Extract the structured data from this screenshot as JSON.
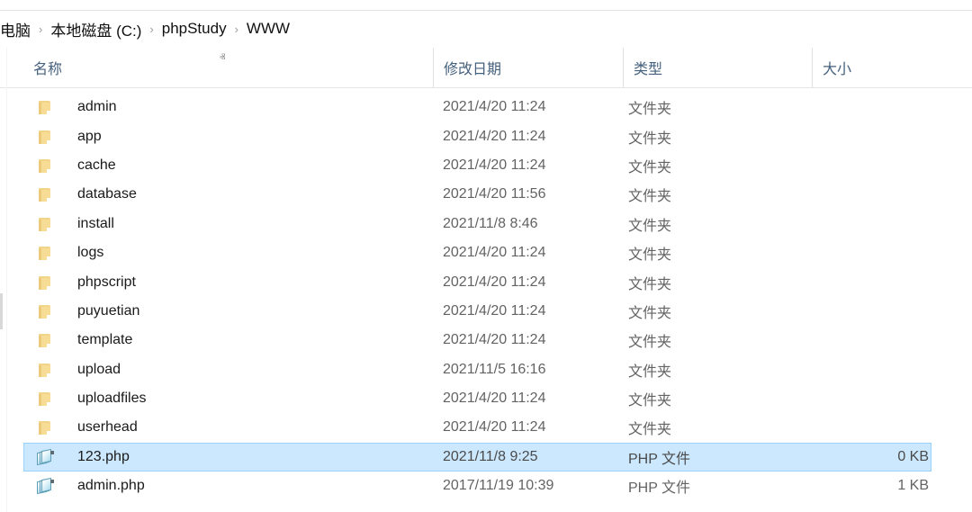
{
  "window": {
    "type": "windows-file-explorer",
    "accent_selection_fill": "#cce8ff",
    "accent_selection_border": "#99d1ff",
    "header_text_color": "#45617d",
    "folder_icon_color": "#f7dc95"
  },
  "breadcrumb": {
    "name": "address-bar",
    "separator": "›",
    "crumbs": [
      {
        "label": "电脑"
      },
      {
        "label": "本地磁盘 (C:)"
      },
      {
        "label": "phpStudy"
      },
      {
        "label": "WWW"
      }
    ]
  },
  "columns": {
    "sort_caret": "ⱏ",
    "sorted_by": "名称",
    "sort_direction": "ascending",
    "headers": [
      {
        "label": "名称",
        "key": "name"
      },
      {
        "label": "修改日期",
        "key": "date"
      },
      {
        "label": "类型",
        "key": "type"
      },
      {
        "label": "大小",
        "key": "size"
      }
    ]
  },
  "file_list": {
    "selected_index": 12,
    "rows": [
      {
        "name": "admin",
        "date": "2021/4/20 11:24",
        "type": "文件夹",
        "size": "",
        "icon": "folder-icon",
        "selected": false
      },
      {
        "name": "app",
        "date": "2021/4/20 11:24",
        "type": "文件夹",
        "size": "",
        "icon": "folder-icon",
        "selected": false
      },
      {
        "name": "cache",
        "date": "2021/4/20 11:24",
        "type": "文件夹",
        "size": "",
        "icon": "folder-icon",
        "selected": false
      },
      {
        "name": "database",
        "date": "2021/4/20 11:56",
        "type": "文件夹",
        "size": "",
        "icon": "folder-icon",
        "selected": false
      },
      {
        "name": "install",
        "date": "2021/11/8 8:46",
        "type": "文件夹",
        "size": "",
        "icon": "folder-icon",
        "selected": false
      },
      {
        "name": "logs",
        "date": "2021/4/20 11:24",
        "type": "文件夹",
        "size": "",
        "icon": "folder-icon",
        "selected": false
      },
      {
        "name": "phpscript",
        "date": "2021/4/20 11:24",
        "type": "文件夹",
        "size": "",
        "icon": "folder-icon",
        "selected": false
      },
      {
        "name": "puyuetian",
        "date": "2021/4/20 11:24",
        "type": "文件夹",
        "size": "",
        "icon": "folder-icon",
        "selected": false
      },
      {
        "name": "template",
        "date": "2021/4/20 11:24",
        "type": "文件夹",
        "size": "",
        "icon": "folder-icon",
        "selected": false
      },
      {
        "name": "upload",
        "date": "2021/11/5 16:16",
        "type": "文件夹",
        "size": "",
        "icon": "folder-icon",
        "selected": false
      },
      {
        "name": "uploadfiles",
        "date": "2021/4/20 11:24",
        "type": "文件夹",
        "size": "",
        "icon": "folder-icon",
        "selected": false
      },
      {
        "name": "userhead",
        "date": "2021/4/20 11:24",
        "type": "文件夹",
        "size": "",
        "icon": "folder-icon",
        "selected": false
      },
      {
        "name": "123.php",
        "date": "2021/11/8 9:25",
        "type": "PHP 文件",
        "size": "0 KB",
        "icon": "php-file-icon",
        "selected": true
      },
      {
        "name": "admin.php",
        "date": "2017/11/19 10:39",
        "type": "PHP 文件",
        "size": "1 KB",
        "icon": "php-file-icon",
        "selected": false
      }
    ]
  }
}
